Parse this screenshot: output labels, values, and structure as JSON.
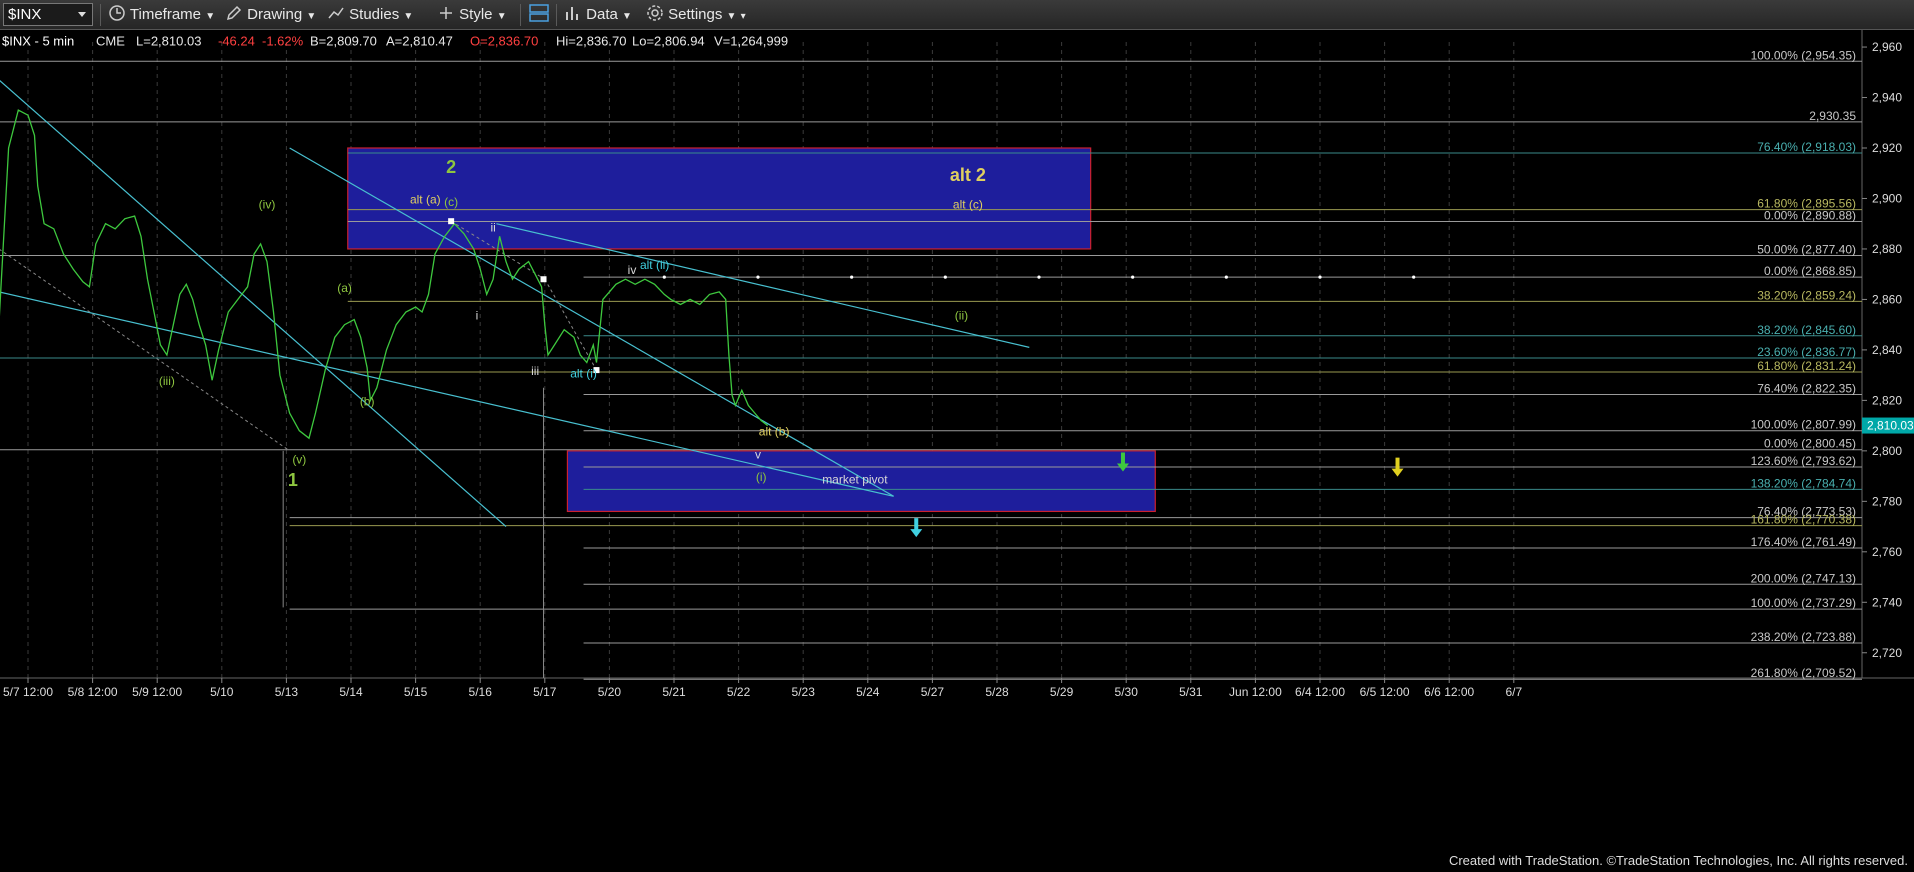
{
  "toolbar": {
    "symbol": "$INX",
    "timeframe": "Timeframe",
    "drawing": "Drawing",
    "studies": "Studies",
    "style": "Style",
    "data": "Data",
    "settings": "Settings"
  },
  "status": {
    "symbol": "$INX - 5 min",
    "exchange": "CME",
    "last": "L=2,810.03",
    "change": "-46.24",
    "pct": "-1.62%",
    "bid": "B=2,809.70",
    "ask": "A=2,810.47",
    "open": "O=2,836.70",
    "high": "Hi=2,836.70",
    "low": "Lo=2,806.94",
    "volume": "V=1,264,999"
  },
  "colors": {
    "bullet": "#1e1e9c",
    "boxBorder": "#cc2030",
    "wave": "#3ec83e",
    "trend": "#48c0d0",
    "greenLabel": "#8ec640",
    "yellowLabel": "#e0d060",
    "cyanLabel": "#40d0e0",
    "price": "#00a8a8"
  },
  "footer": "Created with TradeStation. ©TradeStation Technologies, Inc. All rights reserved.",
  "chart_data": {
    "type": "line",
    "title": "$INX - 5 min",
    "ylim": [
      2710,
      2962
    ],
    "y_ticks": [
      "2,960",
      "2,940",
      "2,920",
      "2,900",
      "2,880",
      "2,860",
      "2,840",
      "2,820",
      "2,800",
      "2,780",
      "2,760",
      "2,740",
      "2,720"
    ],
    "y_tick_values": [
      2960,
      2940,
      2920,
      2900,
      2880,
      2860,
      2840,
      2820,
      2800,
      2780,
      2760,
      2740,
      2720
    ],
    "x_ticks": [
      "5/7 12:00",
      "5/8 12:00",
      "5/9 12:00",
      "5/10",
      "5/13",
      "5/14",
      "5/15",
      "5/16",
      "5/17",
      "5/20",
      "5/21",
      "5/22",
      "5/23",
      "5/24",
      "5/27",
      "5/28",
      "5/29",
      "5/30",
      "5/31",
      "Jun 12:00",
      "6/4 12:00",
      "6/5 12:00",
      "6/6 12:00",
      "6/7"
    ],
    "x_tick_positions": [
      0,
      1,
      2,
      3,
      4,
      5,
      6,
      7,
      8,
      9,
      10,
      11,
      12,
      13,
      14,
      15,
      16,
      17,
      18,
      19,
      20,
      21,
      22,
      23
    ],
    "last_price": "2,810.03",
    "series": [
      {
        "points": [
          [
            -0.45,
            2850
          ],
          [
            -0.3,
            2920
          ],
          [
            -0.15,
            2935
          ],
          [
            0,
            2933
          ],
          [
            0.1,
            2925
          ],
          [
            0.15,
            2905
          ],
          [
            0.25,
            2890
          ],
          [
            0.4,
            2888
          ],
          [
            0.55,
            2878
          ],
          [
            0.7,
            2872
          ],
          [
            0.85,
            2867
          ],
          [
            0.95,
            2865
          ],
          [
            1.05,
            2882
          ],
          [
            1.2,
            2890
          ],
          [
            1.35,
            2888
          ],
          [
            1.5,
            2892
          ],
          [
            1.65,
            2893
          ],
          [
            1.75,
            2885
          ],
          [
            1.85,
            2868
          ],
          [
            1.95,
            2855
          ],
          [
            2.05,
            2842
          ],
          [
            2.15,
            2838
          ],
          [
            2.25,
            2850
          ],
          [
            2.35,
            2862
          ],
          [
            2.45,
            2866
          ],
          [
            2.55,
            2860
          ],
          [
            2.65,
            2850
          ],
          [
            2.75,
            2842
          ],
          [
            2.85,
            2828
          ],
          [
            2.95,
            2840
          ],
          [
            3.1,
            2855
          ],
          [
            3.25,
            2860
          ],
          [
            3.4,
            2865
          ],
          [
            3.5,
            2878
          ],
          [
            3.6,
            2882
          ],
          [
            3.7,
            2875
          ],
          [
            3.8,
            2855
          ],
          [
            3.9,
            2830
          ],
          [
            4.05,
            2815
          ],
          [
            4.2,
            2808
          ],
          [
            4.35,
            2805
          ],
          [
            4.45,
            2815
          ],
          [
            4.6,
            2832
          ],
          [
            4.75,
            2845
          ],
          [
            4.9,
            2850
          ],
          [
            5.05,
            2852
          ],
          [
            5.15,
            2845
          ],
          [
            5.25,
            2833
          ],
          [
            5.3,
            2820
          ],
          [
            5.4,
            2825
          ],
          [
            5.55,
            2840
          ],
          [
            5.7,
            2850
          ],
          [
            5.85,
            2855
          ],
          [
            6.0,
            2857
          ],
          [
            6.1,
            2855
          ],
          [
            6.2,
            2862
          ],
          [
            6.3,
            2878
          ],
          [
            6.45,
            2885
          ],
          [
            6.6,
            2890
          ],
          [
            6.75,
            2886
          ],
          [
            6.9,
            2880
          ],
          [
            7.0,
            2872
          ],
          [
            7.1,
            2862
          ],
          [
            7.2,
            2868
          ],
          [
            7.3,
            2885
          ],
          [
            7.4,
            2875
          ],
          [
            7.5,
            2868
          ],
          [
            7.6,
            2872
          ],
          [
            7.75,
            2875
          ],
          [
            7.85,
            2870
          ],
          [
            7.95,
            2865
          ],
          [
            8.0,
            2850
          ],
          [
            8.05,
            2838
          ],
          [
            8.15,
            2842
          ],
          [
            8.3,
            2848
          ],
          [
            8.45,
            2845
          ],
          [
            8.55,
            2838
          ],
          [
            8.65,
            2835
          ],
          [
            8.75,
            2842
          ],
          [
            8.8,
            2835
          ],
          [
            8.9,
            2860
          ],
          [
            9.0,
            2863
          ],
          [
            9.1,
            2866
          ],
          [
            9.25,
            2868
          ],
          [
            9.4,
            2866
          ],
          [
            9.55,
            2868
          ],
          [
            9.7,
            2866
          ],
          [
            9.85,
            2862
          ],
          [
            9.95,
            2860
          ],
          [
            10.1,
            2858
          ],
          [
            10.25,
            2860
          ],
          [
            10.4,
            2858
          ],
          [
            10.55,
            2862
          ],
          [
            10.7,
            2863
          ],
          [
            10.8,
            2860
          ],
          [
            10.85,
            2838
          ],
          [
            10.9,
            2822
          ],
          [
            10.95,
            2818
          ],
          [
            11.05,
            2824
          ],
          [
            11.15,
            2818
          ],
          [
            11.25,
            2815
          ],
          [
            11.35,
            2812
          ],
          [
            11.45,
            2810
          ]
        ]
      }
    ],
    "fib_labels": [
      {
        "text": "100.00% (2,954.35)",
        "value": 2954.35
      },
      {
        "text": "2,930.35",
        "value": 2930.35
      },
      {
        "text": "76.40% (2,918.03)",
        "value": 2918.03
      },
      {
        "text": "61.80% (2,895.56)",
        "value": 2895.56
      },
      {
        "text": "0.00% (2,890.88)",
        "value": 2890.88
      },
      {
        "text": "50.00% (2,877.40)",
        "value": 2877.4
      },
      {
        "text": "0.00% (2,868.85)",
        "value": 2868.85
      },
      {
        "text": "38.20% (2,859.24)",
        "value": 2859.24
      },
      {
        "text": "38.20% (2,845.60)",
        "value": 2845.6
      },
      {
        "text": "23.60% (2,836.77)",
        "value": 2836.77
      },
      {
        "text": "61.80% (2,831.24)",
        "value": 2831.24
      },
      {
        "text": "76.40% (2,822.35)",
        "value": 2822.35
      },
      {
        "text": "100.00% (2,807.99)",
        "value": 2807.99
      },
      {
        "text": "0.00% (2,800.45)",
        "value": 2800.45
      },
      {
        "text": "123.60% (2,793.62)",
        "value": 2793.62
      },
      {
        "text": "138.20% (2,784.74)",
        "value": 2784.74
      },
      {
        "text": "76.40% (2,773.53)",
        "value": 2773.53
      },
      {
        "text": "161.80% (2,770.38)",
        "value": 2770.38
      },
      {
        "text": "176.40% (2,761.49)",
        "value": 2761.49
      },
      {
        "text": "200.00% (2,747.13)",
        "value": 2747.13
      },
      {
        "text": "100.00% (2,737.29)",
        "value": 2737.29
      },
      {
        "text": "238.20% (2,723.88)",
        "value": 2723.88
      },
      {
        "text": "261.80% (2,709.52)",
        "value": 2709.52
      }
    ],
    "wave_labels": [
      {
        "text": "(iv)",
        "x": 3.7,
        "y": 2896,
        "color": "green"
      },
      {
        "text": "(iii)",
        "x": 2.15,
        "y": 2826,
        "color": "green"
      },
      {
        "text": "(v)",
        "x": 4.2,
        "y": 2795,
        "color": "green"
      },
      {
        "text": "1",
        "x": 4.1,
        "y": 2786,
        "color": "green",
        "big": true
      },
      {
        "text": "(a)",
        "x": 4.9,
        "y": 2863,
        "color": "green"
      },
      {
        "text": "(b)",
        "x": 5.25,
        "y": 2818,
        "color": "green"
      },
      {
        "text": "2",
        "x": 6.55,
        "y": 2910,
        "color": "green",
        "big": true
      },
      {
        "text": "alt (a)",
        "x": 6.15,
        "y": 2898,
        "color": "yellow"
      },
      {
        "text": "(c)",
        "x": 6.55,
        "y": 2897,
        "color": "green"
      },
      {
        "text": "ii",
        "x": 7.2,
        "y": 2887,
        "color": "white"
      },
      {
        "text": "i",
        "x": 6.95,
        "y": 2852,
        "color": "white"
      },
      {
        "text": "iii",
        "x": 7.85,
        "y": 2830,
        "color": "white"
      },
      {
        "text": "alt (i)",
        "x": 8.6,
        "y": 2829,
        "color": "cyan"
      },
      {
        "text": "iv",
        "x": 9.35,
        "y": 2870,
        "color": "white"
      },
      {
        "text": "alt (ii)",
        "x": 9.7,
        "y": 2872,
        "color": "cyan"
      },
      {
        "text": "alt (b)",
        "x": 11.55,
        "y": 2806,
        "color": "yellow"
      },
      {
        "text": "v",
        "x": 11.3,
        "y": 2797,
        "color": "white"
      },
      {
        "text": "(i)",
        "x": 11.35,
        "y": 2788,
        "color": "green"
      },
      {
        "text": "alt 2",
        "x": 14.55,
        "y": 2907,
        "color": "yellow",
        "big": true
      },
      {
        "text": "alt (c)",
        "x": 14.55,
        "y": 2896,
        "color": "yellow"
      },
      {
        "text": "(ii)",
        "x": 14.45,
        "y": 2852,
        "color": "green"
      },
      {
        "text": "market pivot",
        "x": 12.8,
        "y": 2787,
        "color": "white"
      }
    ],
    "grid": true
  }
}
